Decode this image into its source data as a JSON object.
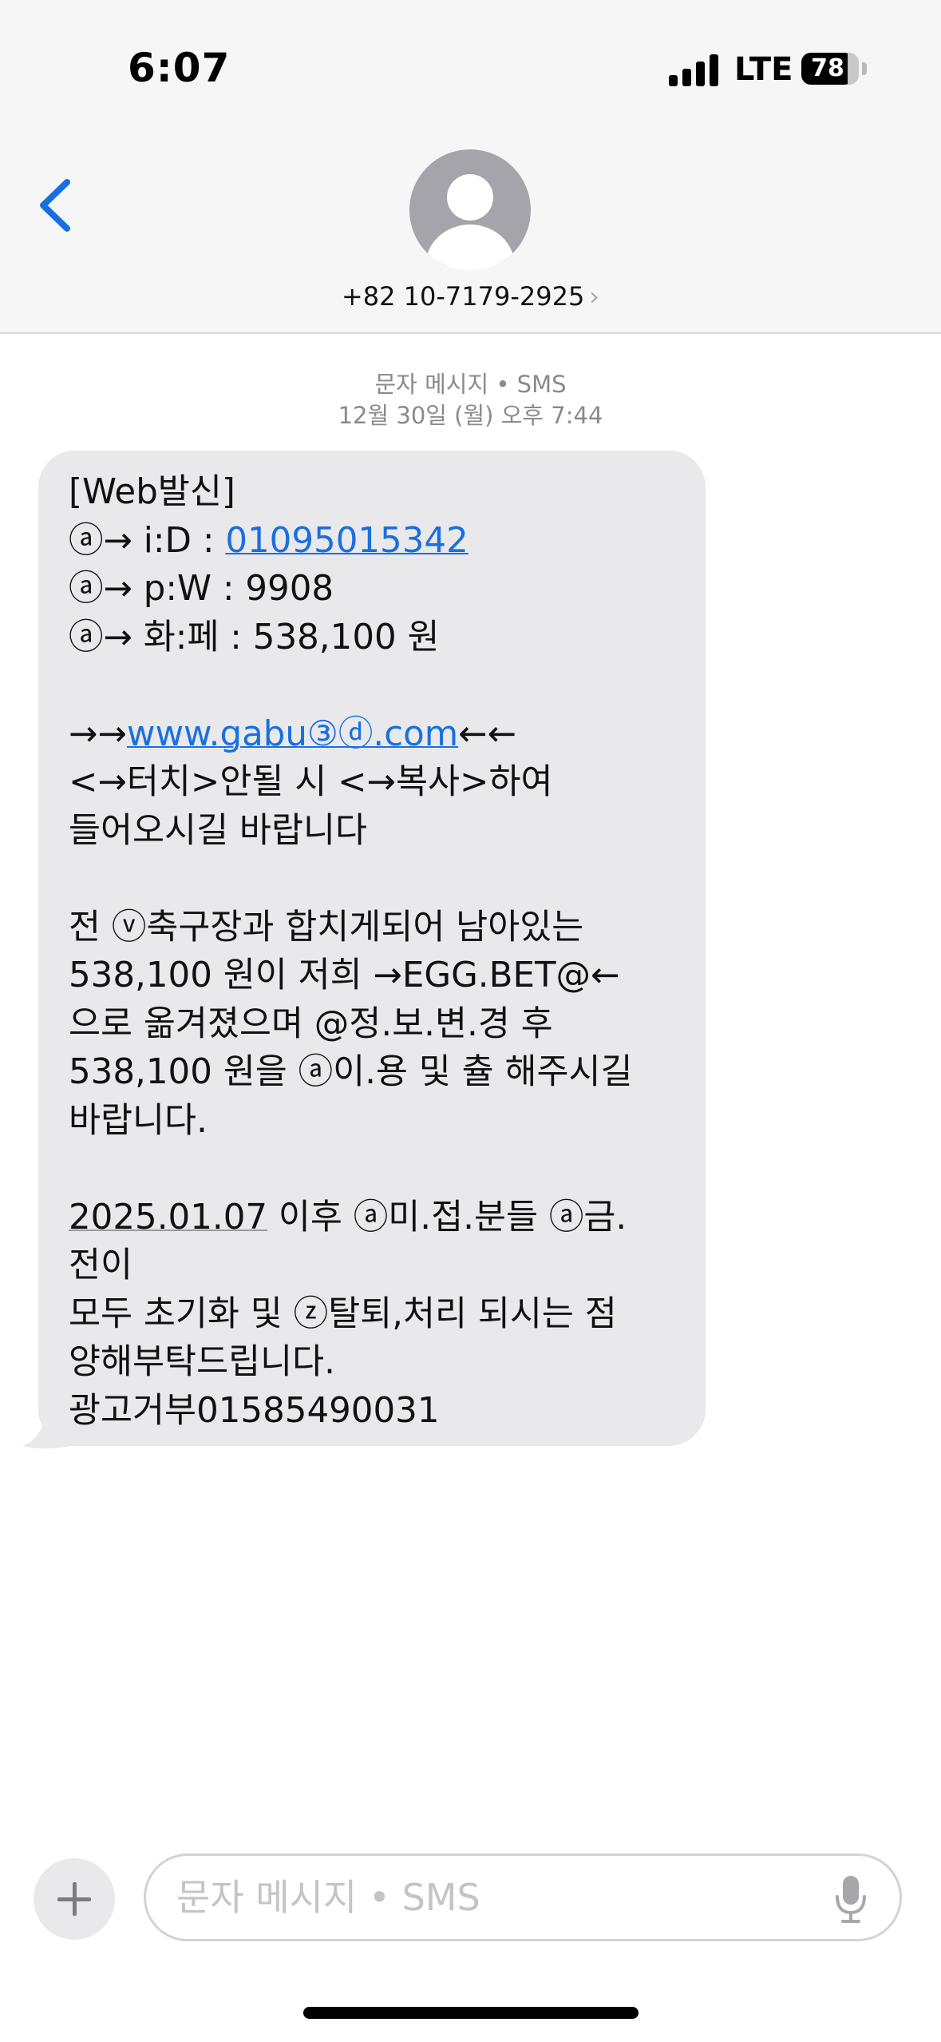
{
  "status_bar": {
    "time": "6:07",
    "network": "LTE",
    "battery": "78"
  },
  "header": {
    "contact": "+82 10-7179-2925",
    "chevron": "›"
  },
  "thread": {
    "service": "문자 메시지 • SMS",
    "timestamp": "12월 30일 (월) 오후 7:44"
  },
  "message": {
    "lines": [
      {
        "segments": [
          {
            "text": "[Web발신]"
          }
        ]
      },
      {
        "segments": [
          {
            "text": "ⓐ→ i:D  : "
          },
          {
            "text": "01095015342",
            "link": true
          }
        ]
      },
      {
        "segments": [
          {
            "text": "ⓐ→ p:W  : 9908"
          }
        ]
      },
      {
        "segments": [
          {
            "text": "ⓐ→ 화:페  : 538,100 원"
          }
        ]
      },
      {
        "segments": [
          {
            "text": ""
          }
        ]
      },
      {
        "segments": [
          {
            "text": "→→"
          },
          {
            "text": "www.gabu③ⓓ.com",
            "link": true
          },
          {
            "text": "←←"
          }
        ]
      },
      {
        "segments": [
          {
            "text": "<→터치>안될 시 <→복사>하여"
          }
        ]
      },
      {
        "segments": [
          {
            "text": "들어오시길 바랍니다"
          }
        ]
      },
      {
        "segments": [
          {
            "text": ""
          }
        ]
      },
      {
        "segments": [
          {
            "text": "전 ⓥ축구장과 합치게되어 남아있는"
          }
        ]
      },
      {
        "segments": [
          {
            "text": "538,100 원이 저희 →EGG.BET@←"
          }
        ]
      },
      {
        "segments": [
          {
            "text": "으로 옮겨졌으며 @정.보.변.경 후"
          }
        ]
      },
      {
        "segments": [
          {
            "text": "538,100 원을 ⓐ이.용 및 츌 해주시길"
          }
        ]
      },
      {
        "segments": [
          {
            "text": "바랍니다."
          }
        ]
      },
      {
        "segments": [
          {
            "text": ""
          }
        ]
      },
      {
        "segments": [
          {
            "text": "2025.01.07",
            "date": true
          },
          {
            "text": " 이후 ⓐ미.접.분들 ⓐ금."
          }
        ]
      },
      {
        "segments": [
          {
            "text": "전이"
          }
        ]
      },
      {
        "segments": [
          {
            "text": "모두 초기화 및 ⓩ탈퇴,처리 되시는 점"
          }
        ]
      },
      {
        "segments": [
          {
            "text": "양해부탁드립니다."
          }
        ]
      },
      {
        "segments": [
          {
            "text": "광고거부01585490031"
          }
        ]
      }
    ]
  },
  "compose": {
    "placeholder": "문자 메시지 • SMS"
  },
  "icons": {
    "back": "chevron-left-icon",
    "avatar": "person-icon",
    "plus": "plus-icon",
    "mic": "microphone-icon",
    "signal": "signal-bars-icon",
    "battery": "battery-icon"
  },
  "colors": {
    "accent": "#1a6fe0",
    "bubble": "#e9e9eb",
    "header_bg": "#f6f6f6"
  }
}
